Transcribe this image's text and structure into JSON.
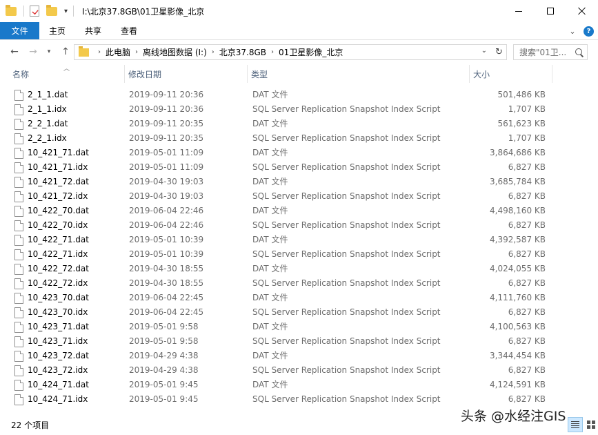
{
  "window": {
    "title": "I:\\北京37.8GB\\01卫星影像_北京"
  },
  "ribbon": {
    "tabs": [
      {
        "label": "文件",
        "active": true
      },
      {
        "label": "主页"
      },
      {
        "label": "共享"
      },
      {
        "label": "查看"
      }
    ],
    "help_label": "?"
  },
  "address": {
    "crumbs": [
      "此电脑",
      "离线地图数据 (I:)",
      "北京37.8GB",
      "01卫星影像_北京"
    ]
  },
  "search": {
    "placeholder": "搜索\"01卫..."
  },
  "columns": {
    "name": "名称",
    "date": "修改日期",
    "type": "类型",
    "size": "大小"
  },
  "files": [
    {
      "name": "2_1_1.dat",
      "date": "2019-09-11 20:36",
      "type": "DAT 文件",
      "size": "501,486 KB"
    },
    {
      "name": "2_1_1.idx",
      "date": "2019-09-11 20:36",
      "type": "SQL Server Replication Snapshot Index Script",
      "size": "1,707 KB"
    },
    {
      "name": "2_2_1.dat",
      "date": "2019-09-11 20:35",
      "type": "DAT 文件",
      "size": "561,623 KB"
    },
    {
      "name": "2_2_1.idx",
      "date": "2019-09-11 20:35",
      "type": "SQL Server Replication Snapshot Index Script",
      "size": "1,707 KB"
    },
    {
      "name": "10_421_71.dat",
      "date": "2019-05-01 11:09",
      "type": "DAT 文件",
      "size": "3,864,686 KB"
    },
    {
      "name": "10_421_71.idx",
      "date": "2019-05-01 11:09",
      "type": "SQL Server Replication Snapshot Index Script",
      "size": "6,827 KB"
    },
    {
      "name": "10_421_72.dat",
      "date": "2019-04-30 19:03",
      "type": "DAT 文件",
      "size": "3,685,784 KB"
    },
    {
      "name": "10_421_72.idx",
      "date": "2019-04-30 19:03",
      "type": "SQL Server Replication Snapshot Index Script",
      "size": "6,827 KB"
    },
    {
      "name": "10_422_70.dat",
      "date": "2019-06-04 22:46",
      "type": "DAT 文件",
      "size": "4,498,160 KB"
    },
    {
      "name": "10_422_70.idx",
      "date": "2019-06-04 22:46",
      "type": "SQL Server Replication Snapshot Index Script",
      "size": "6,827 KB"
    },
    {
      "name": "10_422_71.dat",
      "date": "2019-05-01 10:39",
      "type": "DAT 文件",
      "size": "4,392,587 KB"
    },
    {
      "name": "10_422_71.idx",
      "date": "2019-05-01 10:39",
      "type": "SQL Server Replication Snapshot Index Script",
      "size": "6,827 KB"
    },
    {
      "name": "10_422_72.dat",
      "date": "2019-04-30 18:55",
      "type": "DAT 文件",
      "size": "4,024,055 KB"
    },
    {
      "name": "10_422_72.idx",
      "date": "2019-04-30 18:55",
      "type": "SQL Server Replication Snapshot Index Script",
      "size": "6,827 KB"
    },
    {
      "name": "10_423_70.dat",
      "date": "2019-06-04 22:45",
      "type": "DAT 文件",
      "size": "4,111,760 KB"
    },
    {
      "name": "10_423_70.idx",
      "date": "2019-06-04 22:45",
      "type": "SQL Server Replication Snapshot Index Script",
      "size": "6,827 KB"
    },
    {
      "name": "10_423_71.dat",
      "date": "2019-05-01 9:58",
      "type": "DAT 文件",
      "size": "4,100,563 KB"
    },
    {
      "name": "10_423_71.idx",
      "date": "2019-05-01 9:58",
      "type": "SQL Server Replication Snapshot Index Script",
      "size": "6,827 KB"
    },
    {
      "name": "10_423_72.dat",
      "date": "2019-04-29 4:38",
      "type": "DAT 文件",
      "size": "3,344,454 KB"
    },
    {
      "name": "10_423_72.idx",
      "date": "2019-04-29 4:38",
      "type": "SQL Server Replication Snapshot Index Script",
      "size": "6,827 KB"
    },
    {
      "name": "10_424_71.dat",
      "date": "2019-05-01 9:45",
      "type": "DAT 文件",
      "size": "4,124,591 KB"
    },
    {
      "name": "10_424_71.idx",
      "date": "2019-05-01 9:45",
      "type": "SQL Server Replication Snapshot Index Script",
      "size": "6,827 KB"
    }
  ],
  "status": {
    "count_label": "22 个项目"
  },
  "watermark": "头条 @水经注GIS",
  "colors": {
    "accent": "#1979ca",
    "header_text": "#4c607a",
    "secondary_text": "#6d6d6d",
    "folder": "#f3c94b"
  }
}
